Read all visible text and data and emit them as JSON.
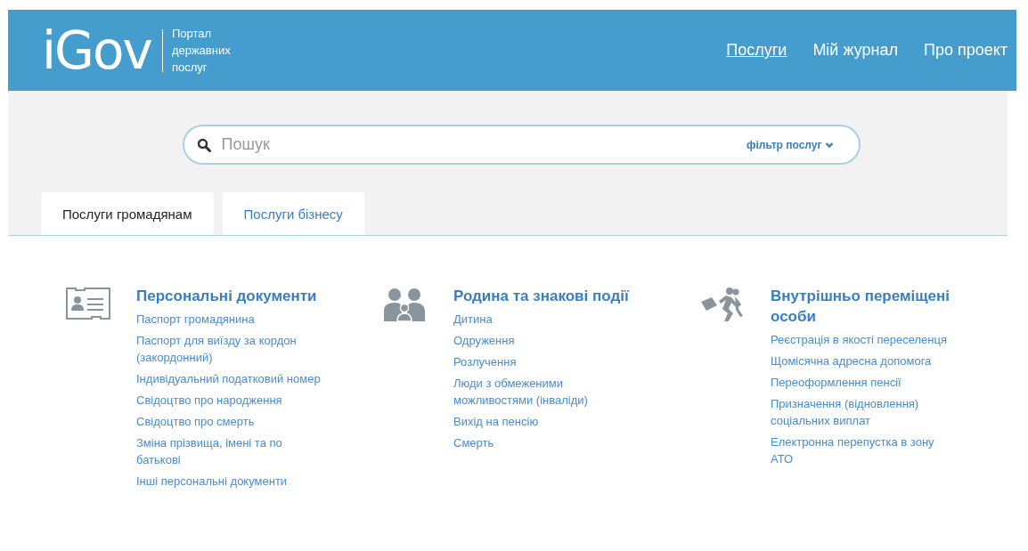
{
  "header": {
    "logo": "iGov",
    "tagline": "Портал державних послуг",
    "nav": [
      {
        "label": "Послуги",
        "selected": true
      },
      {
        "label": "Мій журнал",
        "selected": false
      },
      {
        "label": "Про проект",
        "selected": false
      }
    ]
  },
  "search": {
    "placeholder": "Пошук",
    "filter": "фільтр послуг"
  },
  "tabs": [
    {
      "label": "Послуги громадянам",
      "selected": true
    },
    {
      "label": "Послуги бізнесу",
      "selected": false
    }
  ],
  "categories": [
    {
      "kind": "documents",
      "title": "Персональні документи",
      "links": [
        "Паспорт громадянина",
        "Паспорт для виїзду за кордон (закордонний)",
        "Індивідуальний податковий номер",
        "Свідоцтво про народження",
        "Свідоцтво про смерть",
        "Зміна прізвища, імені та по батькові",
        "Інші персональні документи"
      ]
    },
    {
      "kind": "family",
      "title": "Родина та знакові події",
      "links": [
        "Дитина",
        "Одруження",
        "Розлучення",
        "Люди з обмеженими можливостями (інваліди)",
        "Вихід на пенсію",
        "Смерть"
      ]
    },
    {
      "kind": "displaced",
      "title": "Внутрішньо переміщені особи",
      "links": [
        "Реєстрація в якості переселенця",
        "Щомісячна адресна допомога",
        "Переоформлення пенсії",
        "Призначення (відновлення) соціальних виплат",
        "Електронна перепустка в зону АТО"
      ]
    }
  ]
}
